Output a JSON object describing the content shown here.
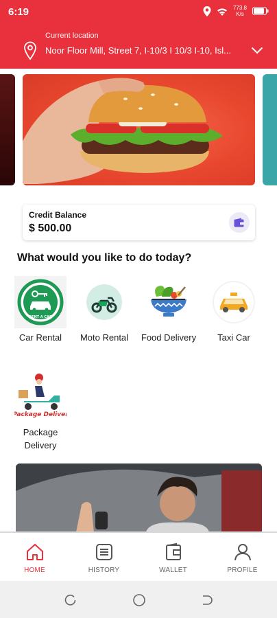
{
  "status": {
    "time": "6:19",
    "speed_value": "773.8",
    "speed_unit": "K/s"
  },
  "location": {
    "caption": "Current location",
    "address": "Noor Floor Mill, Street 7, I-10/3 I 10/3 I-10, Isl..."
  },
  "credit": {
    "label": "Credit Balance",
    "amount": "$ 500.00"
  },
  "section_title": "What would you like to do today?",
  "services": [
    {
      "label": "Car Rental",
      "badge": "RENT A CAR",
      "icon": "car-rental-icon"
    },
    {
      "label": "Moto Rental",
      "icon": "motorbike-icon"
    },
    {
      "label": "Food Delivery",
      "icon": "food-bowl-icon"
    },
    {
      "label": "Taxi Car",
      "icon": "taxi-icon"
    },
    {
      "label": "Package Delivery",
      "badge": "Package Deliver",
      "icon": "delivery-scooter-icon"
    }
  ],
  "nav": [
    {
      "label": "HOME",
      "icon": "home-icon",
      "active": true
    },
    {
      "label": "HISTORY",
      "icon": "history-icon"
    },
    {
      "label": "WALLET",
      "icon": "wallet-icon"
    },
    {
      "label": "PROFILE",
      "icon": "profile-icon"
    }
  ],
  "colors": {
    "brand": "#e8313c",
    "nav_inactive": "#666666",
    "car_rental_green": "#1e9a55"
  }
}
